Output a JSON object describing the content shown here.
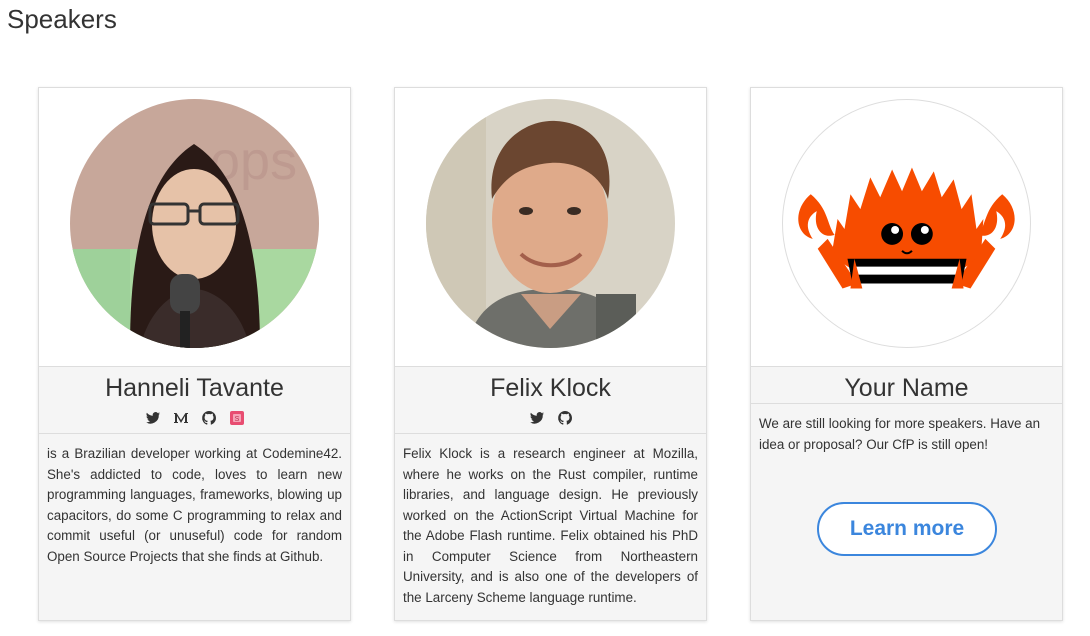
{
  "page": {
    "title": "Speakers"
  },
  "speakers": [
    {
      "name": "Hanneli Tavante",
      "photo_alt": "Hanneli Tavante",
      "social_icons": [
        "twitter-icon",
        "medium-icon",
        "github-icon",
        "speakerdeck-icon"
      ],
      "bio": "is a Brazilian developer working at Codemine42. She's addicted to code, loves to learn new programming languages, frameworks, blowing up capacitors, do some C programming to relax and commit useful (or unuseful) code for random Open Source Projects that she finds at Github."
    },
    {
      "name": "Felix Klock",
      "photo_alt": "Felix Klock",
      "social_icons": [
        "twitter-icon",
        "github-icon"
      ],
      "bio": "Felix Klock is a research engineer at Mozilla, where he works on the Rust compiler, runtime libraries, and language design. He previously worked on the ActionScript Virtual Machine for the Adobe Flash runtime. Felix obtained his PhD in Computer Science from Northeastern University, and is also one of the developers of the Larceny Scheme language runtime."
    },
    {
      "name": "Your Name",
      "photo_alt": "Ferris the crab",
      "bio": "We are still looking for more speakers. Have an idea or proposal? Our CfP is still open!",
      "cta_label": "Learn more"
    }
  ],
  "colors": {
    "accent": "#3b86dd",
    "ferris": "#f74c00",
    "card_bg": "#f5f5f5",
    "border": "#dddddd"
  }
}
